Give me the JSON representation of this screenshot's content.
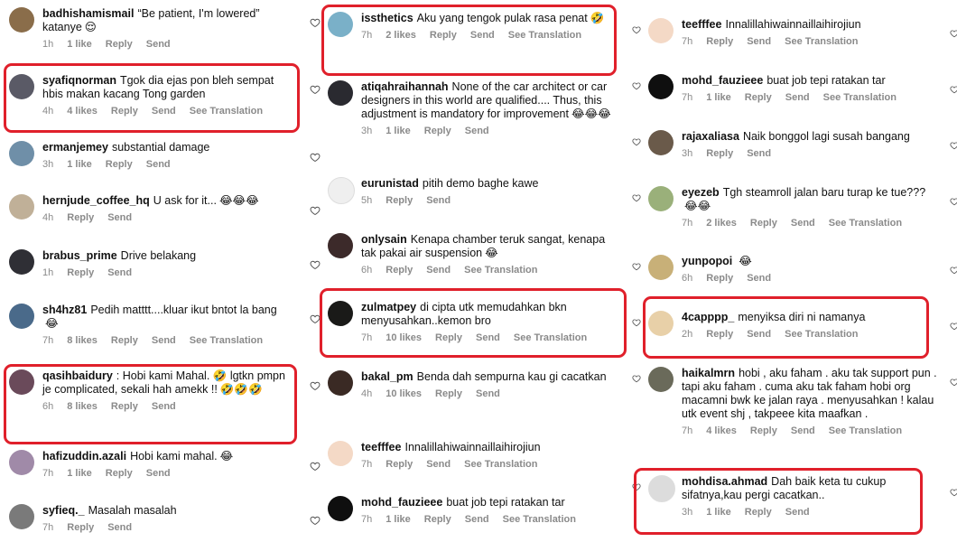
{
  "comments": [
    {
      "username": "badhishamismail",
      "text": "“Be patient, I'm lowered” katanye",
      "emoji": "😌",
      "time": "1h",
      "likes": "1 like",
      "reply": "Reply",
      "send": "Send",
      "translation": ""
    },
    {
      "username": "syafiqnorman",
      "text": "Tgok dia ejas pon bleh sempat hbis makan kacang Tong garden",
      "emoji": "",
      "time": "4h",
      "likes": "4 likes",
      "reply": "Reply",
      "send": "Send",
      "translation": "See Translation"
    },
    {
      "username": "ermanjemey",
      "text": "substantial damage",
      "emoji": "",
      "time": "3h",
      "likes": "1 like",
      "reply": "Reply",
      "send": "Send",
      "translation": ""
    },
    {
      "username": "hernjude_coffee_hq",
      "text": "U ask for it...",
      "emoji": "😂😂😂",
      "time": "4h",
      "likes": "",
      "reply": "Reply",
      "send": "Send",
      "translation": ""
    },
    {
      "username": "brabus_prime",
      "text": "Drive belakang",
      "emoji": "",
      "time": "1h",
      "likes": "",
      "reply": "Reply",
      "send": "Send",
      "translation": ""
    },
    {
      "username": "sh4hz81",
      "text": "Pedih matttt....kluar ikut bntot la bang",
      "emoji": "😂",
      "time": "7h",
      "likes": "8 likes",
      "reply": "Reply",
      "send": "Send",
      "translation": "See Translation"
    },
    {
      "username": "qasihbaidury",
      "text": ": Hobi kami Mahal. 🤣 lgtkn pmpn je complicated, sekali hah amekk !!",
      "emoji": "🤣🤣🤣",
      "time": "6h",
      "likes": "8 likes",
      "reply": "Reply",
      "send": "Send",
      "translation": ""
    },
    {
      "username": "hafizuddin.azali",
      "text": "Hobi kami mahal.",
      "emoji": "😂",
      "time": "7h",
      "likes": "1 like",
      "reply": "Reply",
      "send": "Send",
      "translation": ""
    },
    {
      "username": "syfieq._",
      "text": "Masalah masalah",
      "emoji": "",
      "time": "7h",
      "likes": "",
      "reply": "Reply",
      "send": "Send",
      "translation": ""
    },
    {
      "username": "issthetics",
      "text": "Aku yang tengok pulak rasa penat",
      "emoji": "🤣",
      "time": "7h",
      "likes": "2 likes",
      "reply": "Reply",
      "send": "Send",
      "translation": "See Translation"
    },
    {
      "username": "atiqahraihannah",
      "text": "None of the car architect or car designers in this world are qualified.... Thus, this adjustment is mandatory for improvement",
      "emoji": "😂😂😂",
      "time": "3h",
      "likes": "1 like",
      "reply": "Reply",
      "send": "Send",
      "translation": ""
    },
    {
      "username": "eurunistad",
      "text": "pitih demo baghe kawe",
      "emoji": "",
      "time": "5h",
      "likes": "",
      "reply": "Reply",
      "send": "Send",
      "translation": ""
    },
    {
      "username": "onlysain",
      "text": "Kenapa chamber teruk sangat, kenapa tak pakai air suspension",
      "emoji": "😂",
      "time": "6h",
      "likes": "",
      "reply": "Reply",
      "send": "Send",
      "translation": "See Translation"
    },
    {
      "username": "zulmatpey",
      "text": "di cipta utk memudahkan bkn menyusahkan..kemon bro",
      "emoji": "",
      "time": "7h",
      "likes": "10 likes",
      "reply": "Reply",
      "send": "Send",
      "translation": "See Translation"
    },
    {
      "username": "bakal_pm",
      "text": "Benda dah sempurna kau gi cacatkan",
      "emoji": "",
      "time": "4h",
      "likes": "10 likes",
      "reply": "Reply",
      "send": "Send",
      "translation": ""
    },
    {
      "username": "teefffee",
      "text": "Innalillahiwainnaillaihirojiun",
      "emoji": "",
      "time": "7h",
      "likes": "",
      "reply": "Reply",
      "send": "Send",
      "translation": "See Translation"
    },
    {
      "username": "mohd_fauzieee",
      "text": "buat job tepi ratakan tar",
      "emoji": "",
      "time": "7h",
      "likes": "1 like",
      "reply": "Reply",
      "send": "Send",
      "translation": "See Translation"
    },
    {
      "username": "teefffee",
      "text": "Innalillahiwainnaillaihirojiun",
      "emoji": "",
      "time": "7h",
      "likes": "",
      "reply": "Reply",
      "send": "Send",
      "translation": "See Translation"
    },
    {
      "username": "mohd_fauzieee",
      "text": "buat job tepi ratakan tar",
      "emoji": "",
      "time": "7h",
      "likes": "1 like",
      "reply": "Reply",
      "send": "Send",
      "translation": "See Translation"
    },
    {
      "username": "rajaxaliasa",
      "text": "Naik bonggol lagi susah bangang",
      "emoji": "",
      "time": "3h",
      "likes": "",
      "reply": "Reply",
      "send": "Send",
      "translation": ""
    },
    {
      "username": "eyezeb",
      "text": "Tgh steamroll jalan baru turap ke tue???",
      "emoji": "😂😂",
      "time": "7h",
      "likes": "2 likes",
      "reply": "Reply",
      "send": "Send",
      "translation": "See Translation"
    },
    {
      "username": "yunpopoi",
      "text": "",
      "emoji": "😂",
      "time": "6h",
      "likes": "",
      "reply": "Reply",
      "send": "Send",
      "translation": ""
    },
    {
      "username": "4capppp_",
      "text": "menyiksa diri ni namanya",
      "emoji": "",
      "time": "2h",
      "likes": "",
      "reply": "Reply",
      "send": "Send",
      "translation": "See Translation"
    },
    {
      "username": "haikalmrn",
      "text": "hobi , aku faham . aku tak support pun . tapi aku faham . cuma aku tak faham hobi org macamni bwk ke jalan raya . menyusahkan ! kalau utk event shj , takpeee kita maafkan .",
      "emoji": "",
      "time": "7h",
      "likes": "4 likes",
      "reply": "Reply",
      "send": "Send",
      "translation": "See Translation"
    },
    {
      "username": "mohdisa.ahmad",
      "text": "Dah baik keta tu cukup sifatnya,kau pergi cacatkan..",
      "emoji": "",
      "time": "3h",
      "likes": "1 like",
      "reply": "Reply",
      "send": "Send",
      "translation": ""
    }
  ],
  "colors": {
    "highlight": "#e0202b",
    "meta": "#8a8a8a",
    "text": "#111111"
  },
  "icons": {
    "like": "heart-icon"
  }
}
